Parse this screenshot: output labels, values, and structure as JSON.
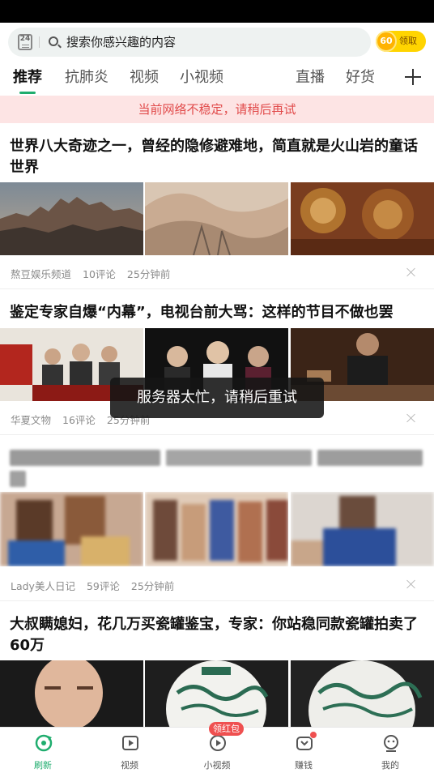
{
  "search": {
    "logo": "24",
    "placeholder": "搜索你感兴趣的内容",
    "coin_value": "60",
    "coin_label": "领取"
  },
  "tabs": [
    {
      "label": "推荐",
      "active": true
    },
    {
      "label": "抗肺炎"
    },
    {
      "label": "视频"
    },
    {
      "label": "小视频"
    },
    {
      "label": "直播"
    },
    {
      "label": "好货"
    }
  ],
  "network_warning": "当前网络不稳定，请稍后再试",
  "articles": [
    {
      "title": "世界八大奇迹之一，曾经的隐修避难地，简直就是火山岩的童话世界",
      "source": "熬豆娱乐频道",
      "comments": "10评论",
      "time": "25分钟前"
    },
    {
      "title": "鉴定专家自爆“内幕”，电视台前大骂：这样的节目不做也罢",
      "source": "华夏文物",
      "comments": "16评论",
      "time": "25分钟前"
    },
    {
      "title": "",
      "source": "Lady美人日记",
      "comments": "59评论",
      "time": "25分钟前"
    },
    {
      "title": "大叔瞒媳妇，花几万买瓷罐鉴宝，专家：你站稳同款瓷罐拍卖了60万",
      "source": "",
      "comments": "",
      "time": ""
    }
  ],
  "toast": "服务器太忙，请稍后重试",
  "bottom_nav": [
    {
      "label": "刷新",
      "icon": "refresh-icon",
      "active": true
    },
    {
      "label": "视频",
      "icon": "video-play-icon"
    },
    {
      "label": "小视频",
      "icon": "short-video-icon",
      "badge": "领红包"
    },
    {
      "label": "赚钱",
      "icon": "earn-money-icon",
      "dot": true
    },
    {
      "label": "我的",
      "icon": "profile-icon"
    }
  ],
  "colors": {
    "accent": "#1fad6e",
    "warning_text": "#e14b4b",
    "warning_bg": "#fde4e4",
    "coin": "#ffd400",
    "badge": "#ef5050"
  }
}
